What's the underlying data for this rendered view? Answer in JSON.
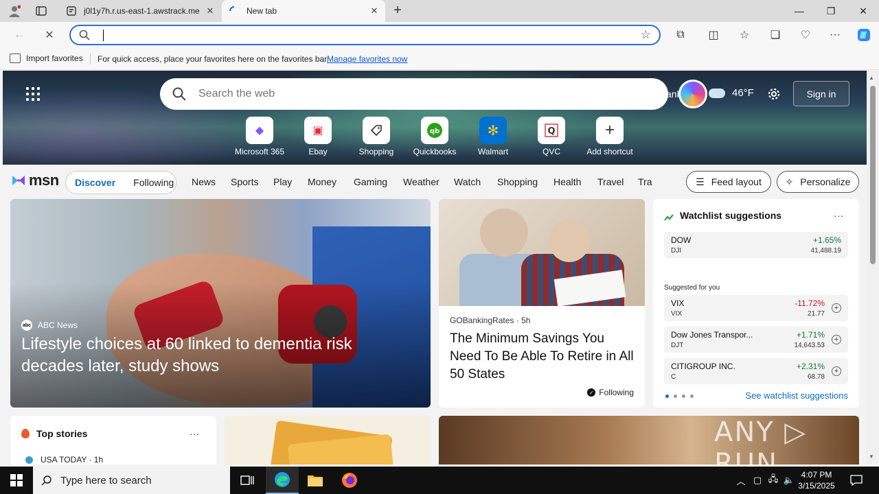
{
  "browser": {
    "tabs": [
      {
        "title": "j0l1y7h.r.us-east-1.awstrack.me",
        "active": false
      },
      {
        "title": "New tab",
        "active": true
      }
    ],
    "address_bar": {
      "value": "",
      "placeholder": ""
    },
    "favorites_bar": {
      "import_label": "Import favorites",
      "message": "For quick access, place your favorites here on the favorites bar.",
      "link": "Manage favorites now"
    }
  },
  "hero": {
    "search_placeholder": "Search the web",
    "location_fragment": "ank",
    "weather": {
      "temp": "46°F",
      "icon": "cloud-icon"
    },
    "signin_label": "Sign in",
    "shortcuts": [
      {
        "label": "Microsoft 365",
        "icon": "microsoft365-icon",
        "glyph": "◆",
        "color": "#7a5cff"
      },
      {
        "label": "Ebay",
        "icon": "ebay-icon",
        "glyph": "▣",
        "color": "#e53238"
      },
      {
        "label": "Shopping",
        "icon": "shopping-tag-icon",
        "glyph": "⌂",
        "color": "#333333"
      },
      {
        "label": "Quickbooks",
        "icon": "quickbooks-icon",
        "glyph": "qb",
        "color": "#2ca01c"
      },
      {
        "label": "Walmart",
        "icon": "walmart-icon",
        "glyph": "✻",
        "color": "#ffc220"
      },
      {
        "label": "QVC",
        "icon": "qvc-icon",
        "glyph": "Q",
        "color": "#333333"
      },
      {
        "label": "Add shortcut",
        "icon": "plus-icon",
        "glyph": "+",
        "color": "#333333"
      }
    ]
  },
  "msn": {
    "logo": "msn",
    "feed_tabs": {
      "discover": "Discover",
      "following": "Following"
    },
    "nav": [
      "News",
      "Sports",
      "Play",
      "Money",
      "Gaming",
      "Weather",
      "Watch",
      "Shopping",
      "Health",
      "Travel",
      "Tra"
    ],
    "feed_layout": "Feed layout",
    "personalize": "Personalize"
  },
  "cards": {
    "hero_story": {
      "source": "ABC News",
      "headline": "Lifestyle choices at 60 linked to dementia risk decades later, study shows"
    },
    "mid_story": {
      "source": "GOBankingRates",
      "age": "5h",
      "headline": "The Minimum Savings You Need To Be Able To Retire in All 50 States",
      "following": "Following"
    },
    "watchlist": {
      "title": "Watchlist suggestions",
      "more": "...",
      "primary": {
        "name": "DOW",
        "symbol": "DJI",
        "change": "+1.65%",
        "price": "41,488.19",
        "dir": "up"
      },
      "suggested_label": "Suggested for you",
      "suggested": [
        {
          "name": "VIX",
          "symbol": "VIX",
          "change": "-11.72%",
          "price": "21.77",
          "dir": "down"
        },
        {
          "name": "Dow Jones Transpor...",
          "symbol": "DJT",
          "change": "+1.71%",
          "price": "14,643.53",
          "dir": "up"
        },
        {
          "name": "CITIGROUP INC.",
          "symbol": "C",
          "change": "+2.31%",
          "price": "68.78",
          "dir": "up"
        }
      ],
      "see_all": "See watchlist suggestions"
    },
    "top_stories": {
      "title": "Top stories",
      "more": "...",
      "source": "USA TODAY · 1h"
    }
  },
  "watermark": "ANY ▷ RUN",
  "taskbar": {
    "search_placeholder": "Type here to search",
    "time": "4:07 PM",
    "date": "3/15/2025"
  }
}
